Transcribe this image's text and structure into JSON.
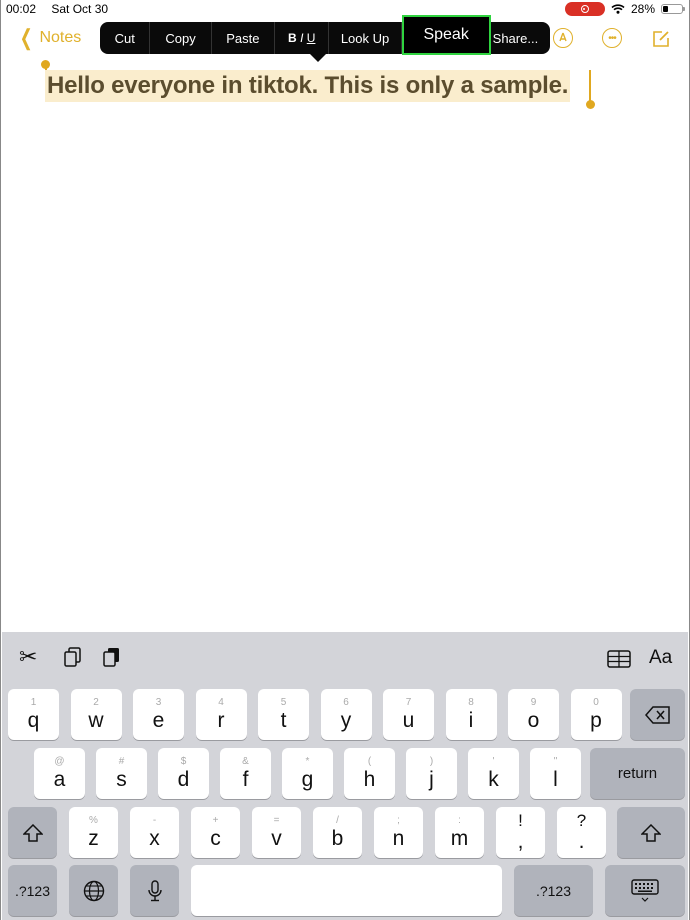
{
  "status_bar": {
    "time": "00:02",
    "date": "Sat Oct 30",
    "battery_percent": "28%",
    "battery_level": 0.28,
    "recording_indicator": "screen-recording-icon"
  },
  "nav": {
    "back_label": "Notes",
    "icons": [
      "markup-pen-icon",
      "more-ellipsis-icon",
      "compose-icon"
    ]
  },
  "edit_menu": {
    "items": [
      "Cut",
      "Copy",
      "Paste",
      "B I U",
      "Look Up",
      "Speak",
      "Share..."
    ],
    "highlighted": "Speak",
    "highlight_color": "#2fd33f"
  },
  "note": {
    "text": "Hello everyone in tiktok. This is only a sample.",
    "selection_color": "#faedcd",
    "accent_color": "#e0b12c"
  },
  "keyboard_toolbar": {
    "left_icons": [
      "scissors-icon",
      "copy-icon",
      "paste-icon"
    ],
    "right_icons": [
      "table-icon"
    ],
    "format_label": "Aa"
  },
  "keyboard": {
    "row1": [
      {
        "sub": "1",
        "main": "q"
      },
      {
        "sub": "2",
        "main": "w"
      },
      {
        "sub": "3",
        "main": "e"
      },
      {
        "sub": "4",
        "main": "r"
      },
      {
        "sub": "5",
        "main": "t"
      },
      {
        "sub": "6",
        "main": "y"
      },
      {
        "sub": "7",
        "main": "u"
      },
      {
        "sub": "8",
        "main": "i"
      },
      {
        "sub": "9",
        "main": "o"
      },
      {
        "sub": "0",
        "main": "p"
      }
    ],
    "row2": [
      {
        "sub": "@",
        "main": "a"
      },
      {
        "sub": "#",
        "main": "s"
      },
      {
        "sub": "$",
        "main": "d"
      },
      {
        "sub": "&",
        "main": "f"
      },
      {
        "sub": "*",
        "main": "g"
      },
      {
        "sub": "(",
        "main": "h"
      },
      {
        "sub": ")",
        "main": "j"
      },
      {
        "sub": "'",
        "main": "k"
      },
      {
        "sub": "\"",
        "main": "l"
      }
    ],
    "row3": [
      {
        "sub": "%",
        "main": "z"
      },
      {
        "sub": "-",
        "main": "x"
      },
      {
        "sub": "+",
        "main": "c"
      },
      {
        "sub": "=",
        "main": "v"
      },
      {
        "sub": "/",
        "main": "b"
      },
      {
        "sub": ";",
        "main": "n"
      },
      {
        "sub": ":",
        "main": "m"
      },
      {
        "sub": "!",
        "main": ","
      },
      {
        "sub": "?",
        "main": "."
      }
    ],
    "return_label": "return",
    "numbers_label": ".?123",
    "delete_icon": "delete-icon",
    "shift_icon": "shift-icon",
    "globe_icon": "globe-icon",
    "mic_icon": "microphone-icon",
    "dismiss_icon": "keyboard-dismiss-icon"
  }
}
